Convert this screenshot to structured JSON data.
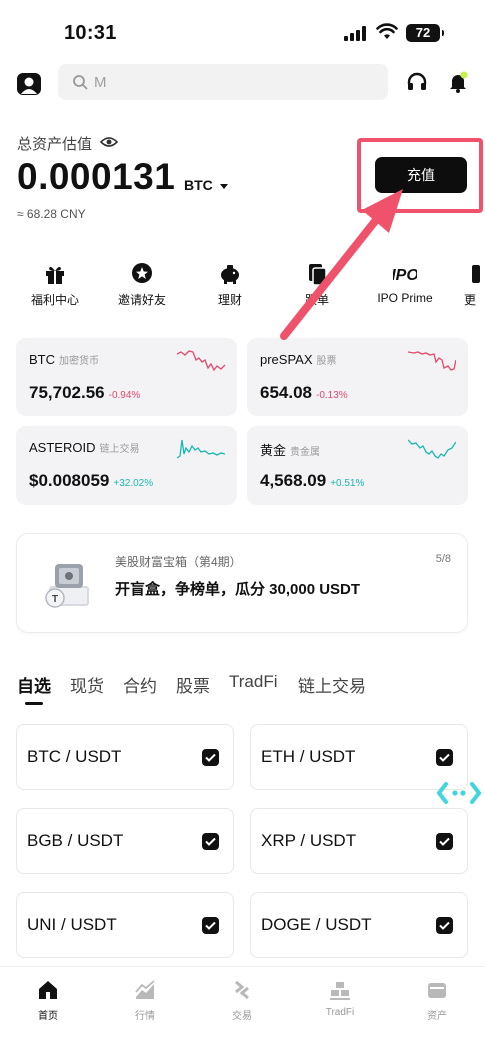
{
  "status_bar": {
    "time": "10:31",
    "battery": "72"
  },
  "search": {
    "placeholder": "M"
  },
  "asset": {
    "label": "总资产估值",
    "value": "0.000131",
    "unit": "BTC",
    "cny": "≈ 68.28 CNY"
  },
  "deposit_label": "充值",
  "quick_actions": [
    {
      "label": "福利中心",
      "icon": "gift-icon"
    },
    {
      "label": "邀请好友",
      "icon": "invite-icon"
    },
    {
      "label": "理财",
      "icon": "piggy-bank-icon"
    },
    {
      "label": "跟单",
      "icon": "copy-trade-icon"
    },
    {
      "label": "IPO Prime",
      "icon": "ipo-icon"
    },
    {
      "label": "更",
      "icon": "more-icon"
    }
  ],
  "market_cards": [
    {
      "name": "BTC",
      "tag": "加密货币",
      "price": "75,702.56",
      "change": "-0.94%",
      "direction": "down"
    },
    {
      "name": "preSPAX",
      "tag": "股票",
      "price": "654.08",
      "change": "-0.13%",
      "direction": "down"
    },
    {
      "name": "ASTEROID",
      "tag": "链上交易",
      "price": "$0.008059",
      "change": "+32.02%",
      "direction": "up"
    },
    {
      "name": "黄金",
      "tag": "贵金属",
      "price": "4,568.09",
      "change": "+0.51%",
      "direction": "up"
    }
  ],
  "promo": {
    "title": "美股财富宝箱（第4期）",
    "main": "开盲盒，争榜单，瓜分 30,000 USDT",
    "page": "5/8"
  },
  "tabs": [
    "自选",
    "现货",
    "合约",
    "股票",
    "TradFi",
    "链上交易"
  ],
  "pairs": [
    "BTC / USDT",
    "ETH / USDT",
    "BGB / USDT",
    "XRP / USDT",
    "UNI / USDT",
    "DOGE / USDT"
  ],
  "bottom_nav": [
    {
      "label": "首页",
      "icon": "home-icon"
    },
    {
      "label": "行情",
      "icon": "market-icon"
    },
    {
      "label": "交易",
      "icon": "trade-icon"
    },
    {
      "label": "TradFi",
      "icon": "tradfi-icon"
    },
    {
      "label": "资产",
      "icon": "wallet-icon"
    }
  ],
  "colors": {
    "accent_red": "#f0516b",
    "down": "#e5486b",
    "up": "#19b8b0",
    "primary": "#0d0d0d"
  }
}
